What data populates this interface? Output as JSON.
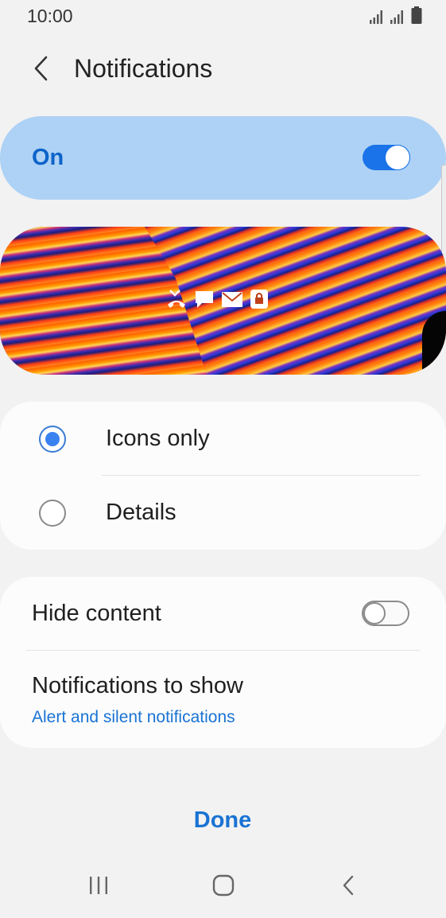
{
  "status_bar": {
    "time": "10:00",
    "icons": [
      "signal-icon",
      "signal-icon",
      "battery-icon"
    ]
  },
  "header": {
    "title": "Notifications",
    "back_icon": "chevron-left-icon"
  },
  "master_switch": {
    "label": "On",
    "state": true,
    "accent_color": "#1a73e8",
    "background_color": "#aed2f5"
  },
  "preview": {
    "icons": [
      "missed-call-icon",
      "message-icon",
      "email-icon",
      "lock-icon"
    ]
  },
  "notification_style": {
    "options": [
      {
        "label": "Icons only",
        "selected": true
      },
      {
        "label": "Details",
        "selected": false
      }
    ]
  },
  "options": {
    "hide_content": {
      "label": "Hide content",
      "state": false
    },
    "notifications_to_show": {
      "label": "Notifications to show",
      "value": "Alert and silent notifications"
    }
  },
  "footer": {
    "done_label": "Done"
  },
  "nav_bar": {
    "icons": [
      "recent-apps-icon",
      "home-icon",
      "back-icon"
    ]
  },
  "colors": {
    "accent": "#1a73d4",
    "background": "#f2f2f2",
    "card": "#fcfcfc"
  }
}
